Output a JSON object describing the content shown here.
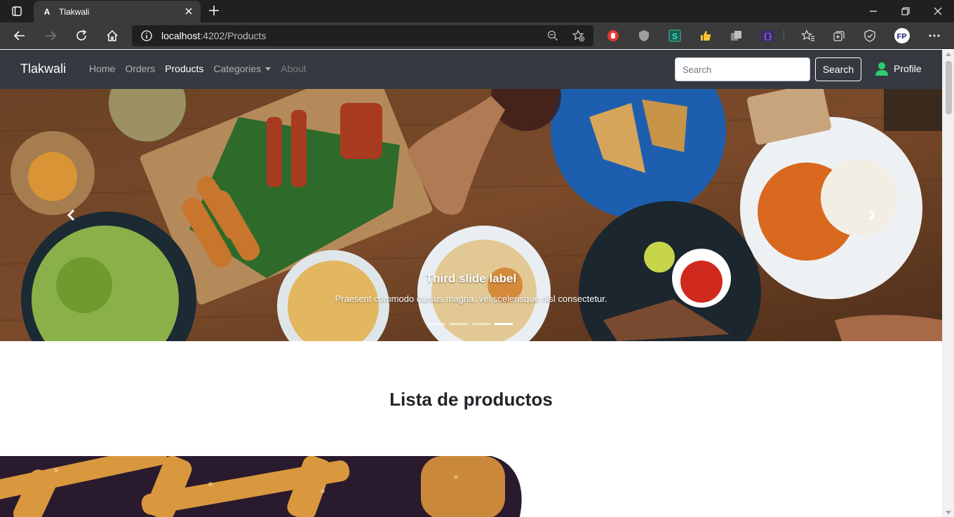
{
  "browser": {
    "tab_title": "Tlakwali",
    "tab_favicon": "A",
    "url_host": "localhost",
    "url_rest": ":4202/Products"
  },
  "navbar": {
    "brand": "Tlakwali",
    "links": [
      {
        "label": "Home"
      },
      {
        "label": "Orders"
      },
      {
        "label": "Products"
      },
      {
        "label": "Categories"
      },
      {
        "label": "About"
      }
    ],
    "search_placeholder": "Search",
    "search_button": "Search",
    "profile": "Profile"
  },
  "carousel": {
    "caption_title": "Third slide label",
    "caption_text": "Praesent commodo cursus magna, vel scelerisque nisl consectetur.",
    "indicators": 4,
    "active_indicator": 4
  },
  "main": {
    "heading": "Lista de productos"
  }
}
